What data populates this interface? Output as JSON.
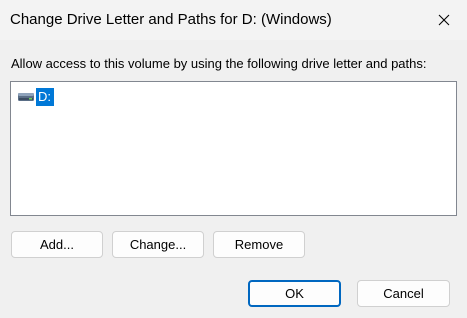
{
  "window": {
    "title": "Change Drive Letter and Paths for D: (Windows)",
    "close_icon": "close-icon"
  },
  "prompt": "Allow access to this volume by using the following drive letter and paths:",
  "list": {
    "items": [
      {
        "label": "D:",
        "icon": "drive-icon",
        "selected": true
      }
    ]
  },
  "buttons": {
    "add": "Add...",
    "change": "Change...",
    "remove": "Remove",
    "ok": "OK",
    "cancel": "Cancel"
  },
  "colors": {
    "selection": "#0078d7",
    "default_button_border": "#0067c0"
  }
}
